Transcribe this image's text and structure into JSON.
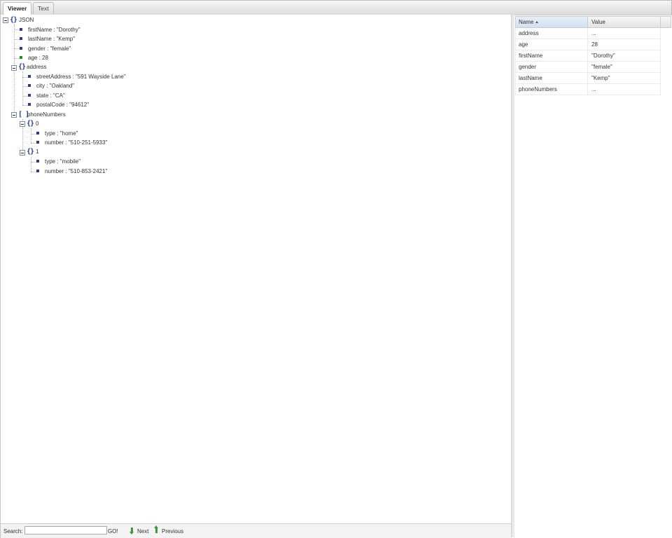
{
  "tabs": [
    {
      "label": "Viewer",
      "active": true
    },
    {
      "label": "Text",
      "active": false
    }
  ],
  "tree": {
    "root_label": "JSON",
    "root_fields": [
      {
        "text": "firstName : \"Dorothy\""
      },
      {
        "text": "lastName : \"Kemp\""
      },
      {
        "text": "gender : \"female\""
      },
      {
        "text": "age : 28",
        "numeric": true
      }
    ],
    "address": {
      "label": "address",
      "fields": [
        {
          "text": "streetAddress : \"591 Wayside Lane\""
        },
        {
          "text": "city : \"Oakland\""
        },
        {
          "text": "state : \"CA\""
        },
        {
          "text": "postalCode : \"94612\""
        }
      ]
    },
    "phoneNumbers": {
      "label": "phoneNumbers",
      "items": [
        {
          "index": "0",
          "fields": [
            {
              "text": "type : \"home\""
            },
            {
              "text": "number : \"510-251-5933\""
            }
          ]
        },
        {
          "index": "1",
          "fields": [
            {
              "text": "type : \"mobile\""
            },
            {
              "text": "number : \"510-853-2421\""
            }
          ]
        }
      ]
    }
  },
  "search": {
    "label": "Search:",
    "value": "",
    "go_label": "GO!",
    "next_label": "Next",
    "previous_label": "Previous"
  },
  "grid": {
    "name_header": "Name",
    "value_header": "Value",
    "rows": [
      {
        "name": "address",
        "value": "..."
      },
      {
        "name": "age",
        "value": "28"
      },
      {
        "name": "firstName",
        "value": "\"Dorothy\""
      },
      {
        "name": "gender",
        "value": "\"female\""
      },
      {
        "name": "lastName",
        "value": "\"Kemp\""
      },
      {
        "name": "phoneNumbers",
        "value": "..."
      }
    ]
  },
  "colors": {
    "bullet": "#2e3c90",
    "numeric_bullet": "#2e8a2e",
    "brace": "#2b3a9a",
    "arrow": "#3a9a3a"
  }
}
